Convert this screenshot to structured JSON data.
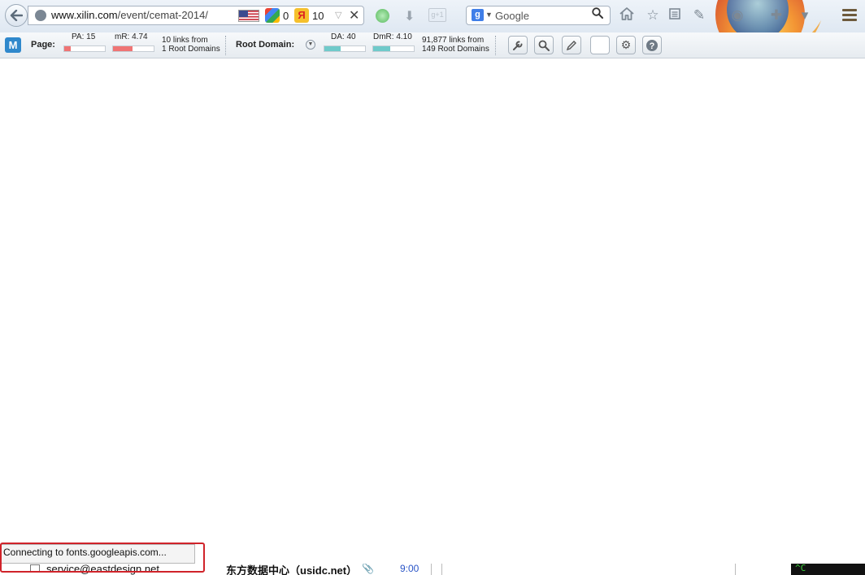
{
  "navbar": {
    "url_host": "www.xilin.com",
    "url_path": "/event/cemat-2014/",
    "google_pagerank": "0",
    "yandex_letter": "Я",
    "yandex_tic": "10",
    "search_engine_letter": "g",
    "search_placeholder": "Google",
    "gplus_label": "g+1"
  },
  "mozbar": {
    "logo_letter": "M",
    "page_label": "Page:",
    "pa_label": "PA: 15",
    "pa_value": 15,
    "mr_label": "mR: 4.74",
    "mr_value": 4.74,
    "page_links_line1": "10 links from",
    "page_links_line2": "1 Root Domains",
    "root_domain_label": "Root Domain:",
    "da_label": "DA: 40",
    "da_value": 40,
    "dmr_label": "DmR: 4.10",
    "dmr_value": 4.1,
    "domain_links_line1": "91,877 links from",
    "domain_links_line2": "149 Root Domains",
    "colors": {
      "page_bar": "#ef7474",
      "domain_bar": "#6fcaca"
    }
  },
  "status": {
    "text": "Connecting to fonts.googleapis.com..."
  },
  "background_window": {
    "email": "service@eastdesign.net",
    "company": "东方数据中心（usidc.net）",
    "time": "9:00",
    "terminal": "^C"
  }
}
